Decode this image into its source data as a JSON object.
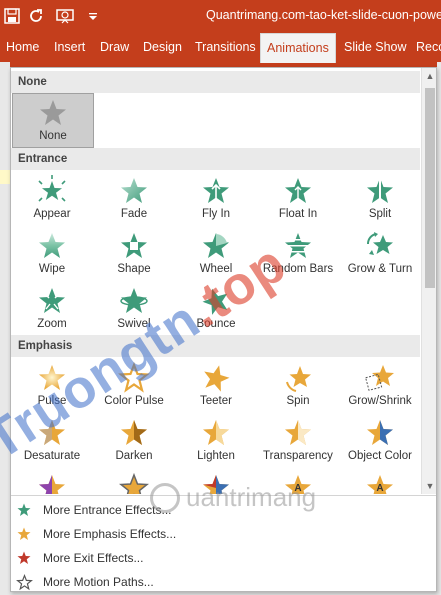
{
  "window": {
    "title": "Quantrimang.com-tao-ket-slide-cuon-powe"
  },
  "ribbon_tabs": [
    "Home",
    "Insert",
    "Draw",
    "Design",
    "Transitions",
    "Animations",
    "Slide Show",
    "Reco"
  ],
  "active_tab": "Animations",
  "gallery": {
    "none_header": "None",
    "none_label": "None",
    "entrance_header": "Entrance",
    "entrance": [
      "Appear",
      "Fade",
      "Fly In",
      "Float In",
      "Split",
      "Wipe",
      "Shape",
      "Wheel",
      "Random Bars",
      "Grow & Turn",
      "Zoom",
      "Swivel",
      "Bounce"
    ],
    "emphasis_header": "Emphasis",
    "emphasis": [
      "Pulse",
      "Color Pulse",
      "Teeter",
      "Spin",
      "Grow/Shrink",
      "Desaturate",
      "Darken",
      "Lighten",
      "Transparency",
      "Object Color"
    ]
  },
  "menu": [
    {
      "label": "More Entrance Effects...",
      "icon": "green-star-icon"
    },
    {
      "label": "More Emphasis Effects...",
      "icon": "gold-star-icon"
    },
    {
      "label": "More Exit Effects...",
      "icon": "red-star-icon"
    },
    {
      "label": "More Motion Paths...",
      "icon": "outline-star-icon"
    }
  ],
  "watermarks": {
    "primary_a": "Truong",
    "primary_b": "tn",
    "primary_c": ".top",
    "secondary": "uantrimang"
  },
  "colors": {
    "accent": "#c43e1c",
    "entrance_star": "#3f9b7a",
    "emphasis_star": "#e8a73a",
    "exit_star": "#c0392b"
  }
}
